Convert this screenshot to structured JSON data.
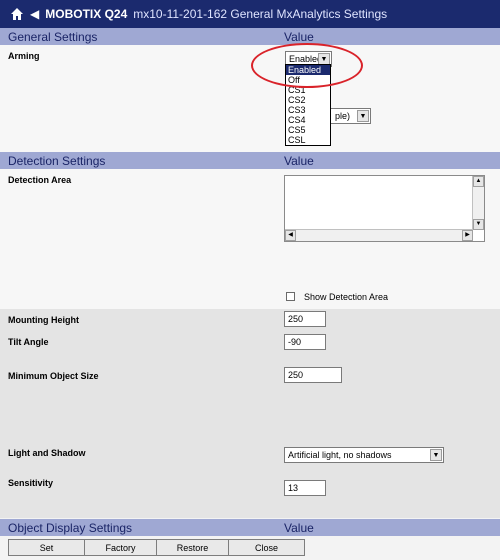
{
  "header": {
    "brand": "MOBOTIX Q24",
    "subtitle": "mx10-11-201-162 General MxAnalytics Settings"
  },
  "sections": {
    "general": {
      "label": "General Settings",
      "value_header": "Value"
    },
    "detection": {
      "label": "Detection Settings",
      "value_header": "Value"
    },
    "object_display": {
      "label": "Object Display Settings",
      "value_header": "Value"
    }
  },
  "arming": {
    "label": "Arming",
    "selected": "Enabled",
    "options": [
      "Enabled",
      "Off",
      "CS1",
      "CS2",
      "CS3",
      "CS4",
      "CS5",
      "CSL"
    ],
    "behind_select_partial": "ple)"
  },
  "detection_area": {
    "label": "Detection Area",
    "show_checkbox_label": "Show Detection Area",
    "show_checked": false
  },
  "mounting_height": {
    "label": "Mounting Height",
    "value": "250"
  },
  "tilt_angle": {
    "label": "Tilt Angle",
    "value": "-90"
  },
  "min_object_size": {
    "label": "Minimum Object Size",
    "value": "250"
  },
  "light_shadow": {
    "label": "Light and Shadow",
    "selected": "Artificial light, no shadows"
  },
  "sensitivity": {
    "label": "Sensitivity",
    "value": "13"
  },
  "buttons": {
    "set": "Set",
    "factory": "Factory",
    "restore": "Restore",
    "close": "Close"
  },
  "colors": {
    "titlebar": "#1b2a6e",
    "section_header": "#9fa8d3",
    "highlight_ellipse": "#d9232a"
  }
}
